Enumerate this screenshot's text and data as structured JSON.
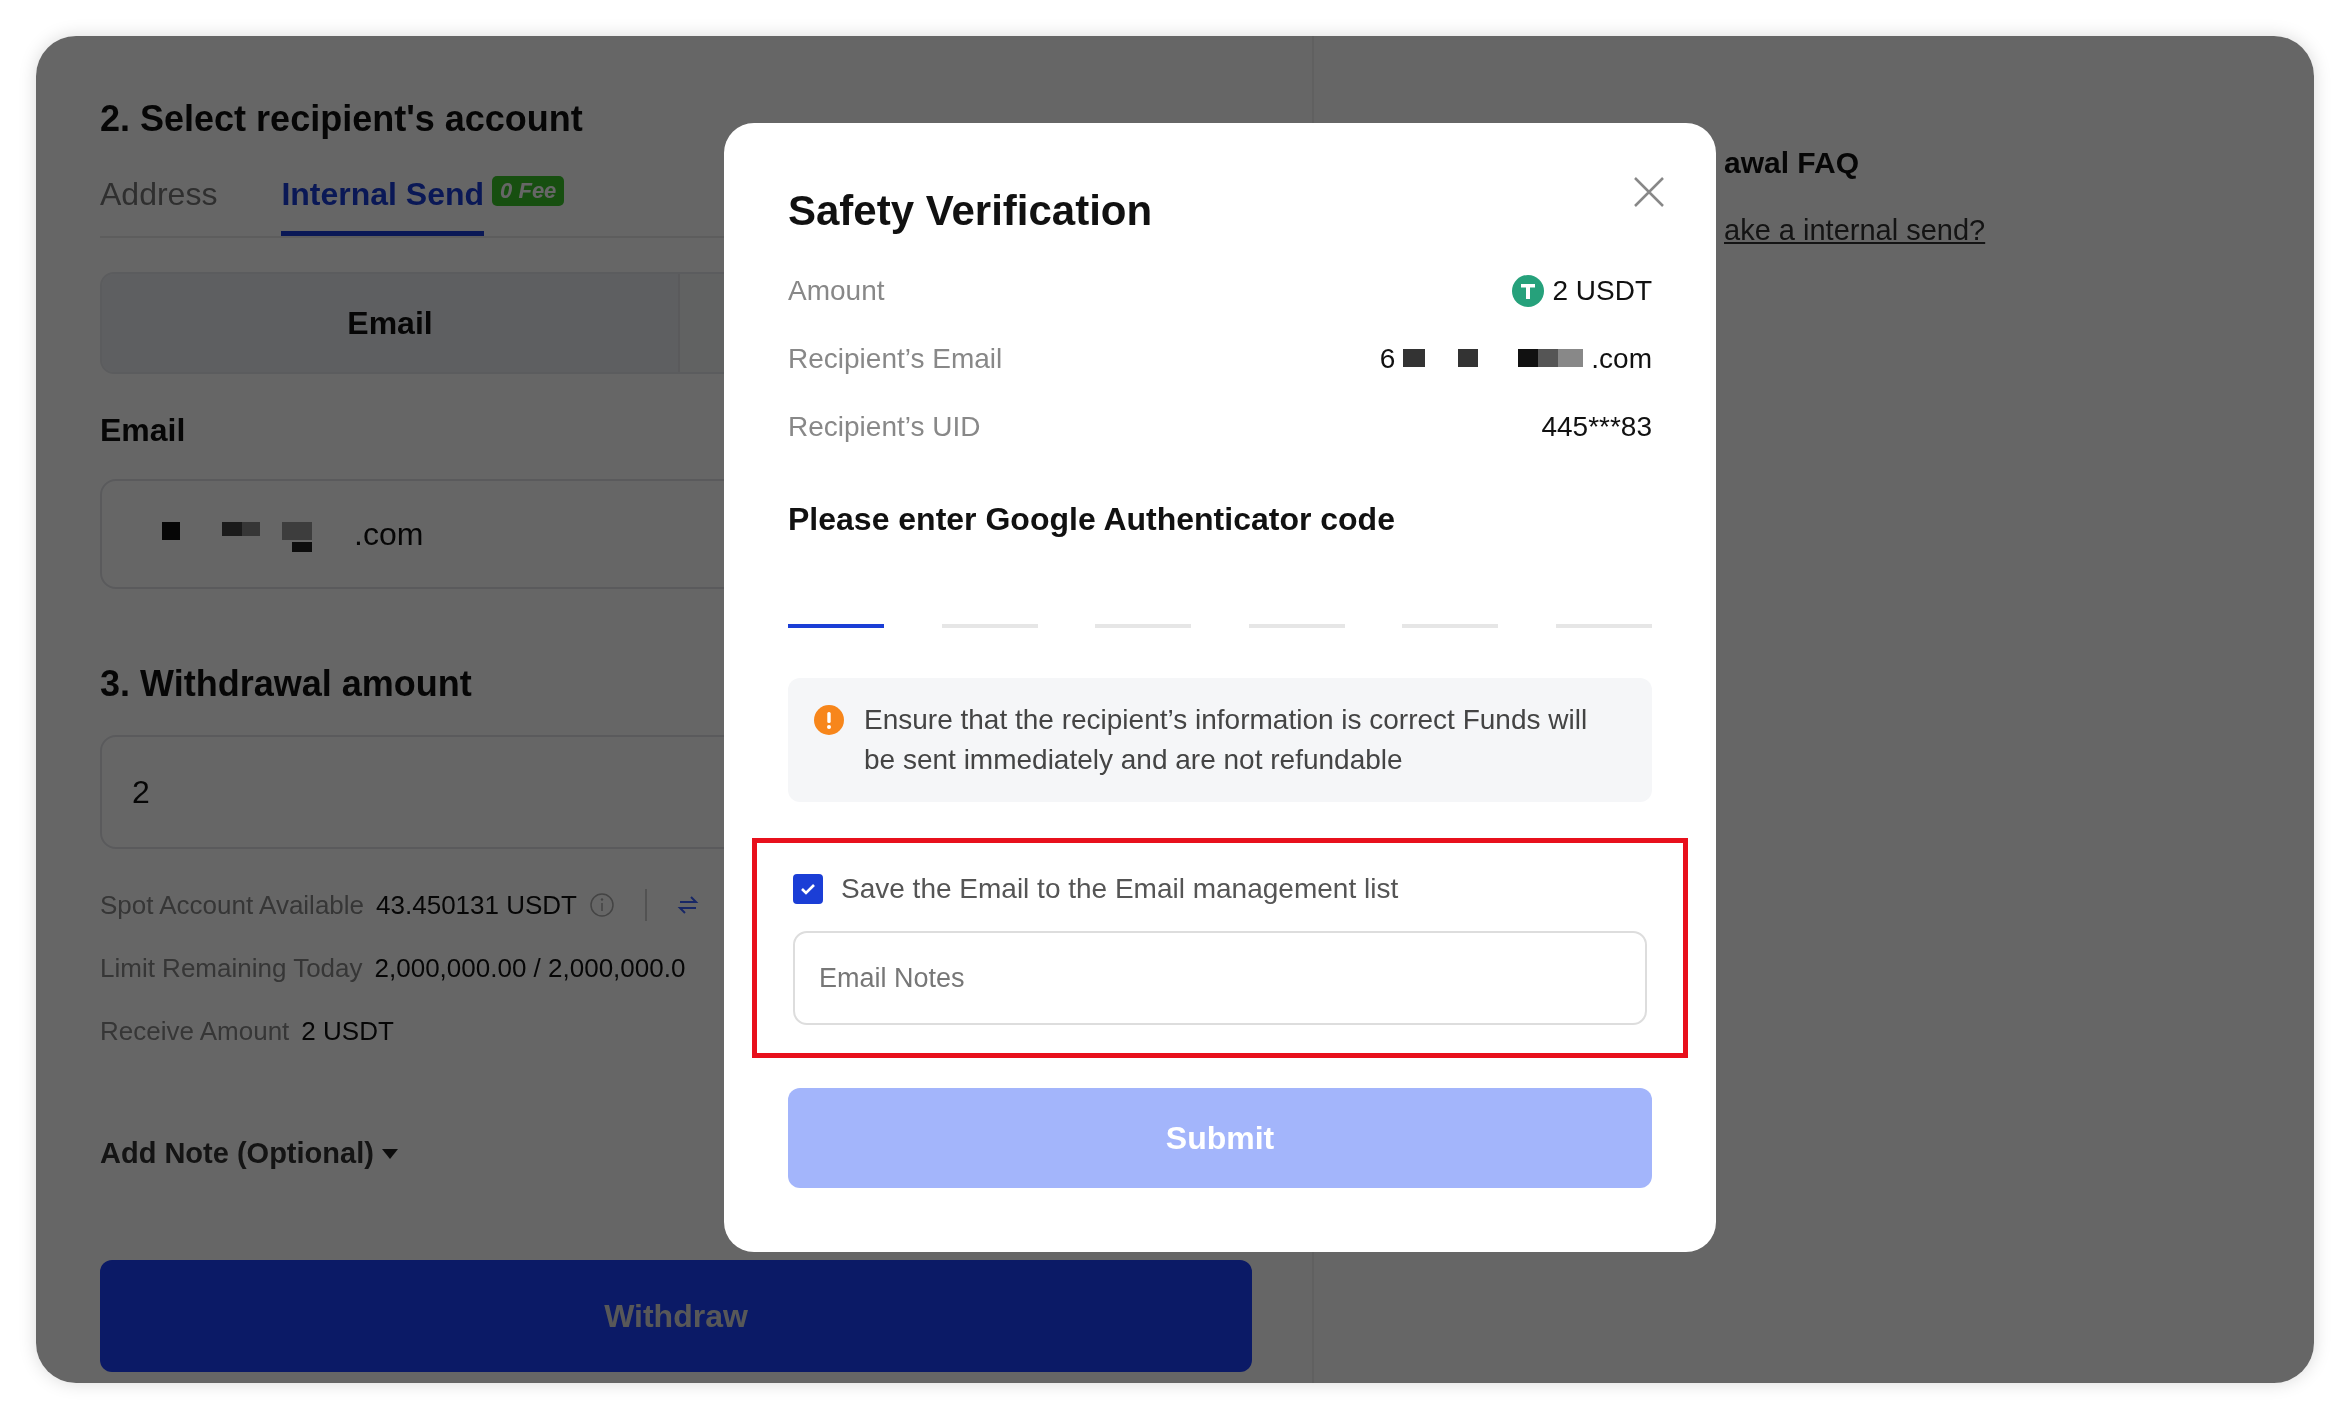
{
  "recipient_section": {
    "title": "2. Select recipient's account",
    "tabs": [
      {
        "label": "Address",
        "selected": false
      },
      {
        "label": "Internal Send",
        "selected": true,
        "badge": "0 Fee"
      }
    ],
    "segments": [
      {
        "label": "Email",
        "selected": true
      },
      {
        "selected": false
      }
    ],
    "email_label": "Email",
    "email_value_suffix": ".com"
  },
  "amount_section": {
    "title": "3. Withdrawal amount",
    "value": "2",
    "info": [
      {
        "label": "Spot Account Available",
        "value": "43.450131 USDT",
        "kind": "balance"
      },
      {
        "label": "Limit Remaining Today",
        "value": "2,000,000.00 / 2,000,000.0",
        "kind": "plain"
      },
      {
        "label": "Receive Amount",
        "value": "2 USDT",
        "kind": "plain"
      }
    ],
    "add_note": "Add Note (Optional)",
    "withdraw_button": "Withdraw"
  },
  "faq": {
    "title": "awal FAQ",
    "link": "ake a internal send?"
  },
  "modal": {
    "title": "Safety Verification",
    "details": [
      {
        "label": "Amount",
        "value": "2 USDT",
        "kind": "coin"
      },
      {
        "label": "Recipient’s Email",
        "value_prefix": "6",
        "value": ".com",
        "kind": "redacted"
      },
      {
        "label": "Recipient’s UID",
        "value": "445***83",
        "kind": "plain"
      }
    ],
    "code_prompt": "Please enter Google Authenticator code",
    "code_slots": [
      {
        "selected": true
      },
      {
        "selected": false
      },
      {
        "selected": false
      },
      {
        "selected": false
      },
      {
        "selected": false
      },
      {
        "selected": false
      }
    ],
    "notice": "Ensure that the recipient’s information is correct Funds will be sent immediately and are not refundable",
    "save_option": {
      "label": "Save the Email to the Email management list",
      "checked": true,
      "highlighted": true
    },
    "notes_field": {
      "placeholder": "Email Notes"
    },
    "submit_button": {
      "label": "Submit",
      "disabled": true
    }
  }
}
